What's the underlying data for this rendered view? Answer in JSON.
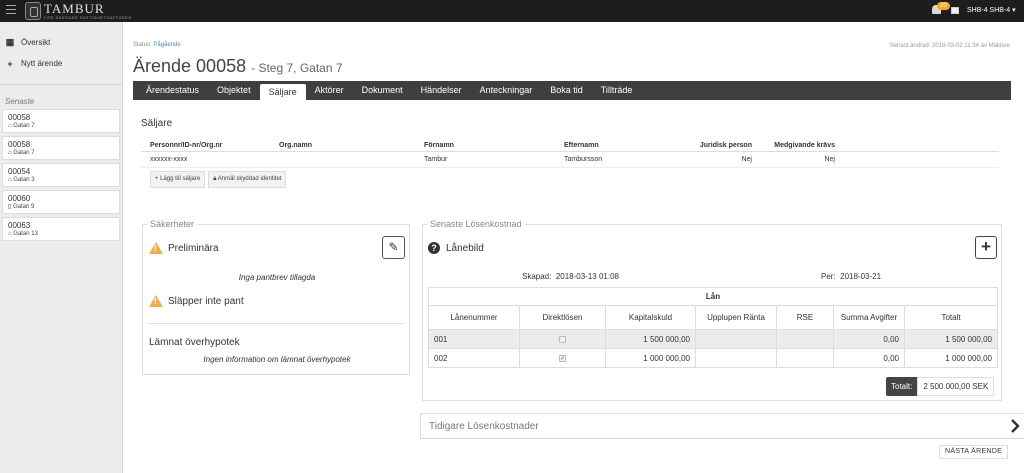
{
  "app": {
    "logo_text": "TAMBUR",
    "logo_sub": "FÖR SÄKRARE FASTIGHETSAFFÄRER",
    "notification_count": "20",
    "user": "SHB-4 SHB-4"
  },
  "sidebar": {
    "nav": [
      {
        "label": "Översikt",
        "icon": "grid-icon"
      },
      {
        "label": "Nytt ärende",
        "icon": "plus-icon"
      }
    ],
    "recent_heading": "Senaste",
    "recent": [
      {
        "number": "00058",
        "address": "Gatan 7",
        "icon": "home-icon"
      },
      {
        "number": "00058",
        "address": "Gatan 7",
        "icon": "home-icon"
      },
      {
        "number": "00054",
        "address": "Gatan 3",
        "icon": "home-icon"
      },
      {
        "number": "00060",
        "address": "Gatan 9",
        "icon": "building-icon"
      },
      {
        "number": "00063",
        "address": "Gatan 13",
        "icon": "home-icon"
      }
    ]
  },
  "header": {
    "status_label": "Status:",
    "status_value": "Pågående",
    "title": "Ärende 00058",
    "subtitle": "- Steg 7, Gatan 7",
    "last_changed": "Senast ändrad: 2018-03-02 11:34 av Mäklare"
  },
  "tabs": [
    {
      "label": "Ärendestatus"
    },
    {
      "label": "Objektet"
    },
    {
      "label": "Säljare",
      "active": true
    },
    {
      "label": "Aktörer"
    },
    {
      "label": "Dokument"
    },
    {
      "label": "Händelser"
    },
    {
      "label": "Anteckningar"
    },
    {
      "label": "Boka tid"
    },
    {
      "label": "Tillträde"
    }
  ],
  "seller": {
    "heading": "Säljare",
    "columns": [
      "Personnr/ID-nr/Org.nr",
      "Org.namn",
      "Förnamn",
      "Efternamn",
      "Juridisk person",
      "Medgivande krävs"
    ],
    "rows": [
      [
        "xxxxxx-xxxx",
        "",
        "Tambur",
        "Tambursson",
        "Nej",
        "Nej"
      ]
    ],
    "add_button": "+ Lägg till säljare",
    "protected_button": "Anmäl skyddad identitet"
  },
  "security": {
    "legend": "Säkerheter",
    "preliminary": "Preliminära",
    "no_mortgage": "Inga pantbrev tillagda",
    "no_release": "Släpper inte pant",
    "surplus_heading": "Lämnat överhypotek",
    "no_surplus": "Ingen information om lämnat överhypotek"
  },
  "redemption": {
    "legend": "Senaste Lösenkostnad",
    "title": "Lånebild",
    "created_label": "Skapad:",
    "created": "2018-03-13 01:08",
    "per_label": "Per:",
    "per": "2018-03-21",
    "table_caption": "Lån",
    "columns": [
      "Lånenummer",
      "Direktlösen",
      "Kapitalskuld",
      "Upplupen Ränta",
      "RSE",
      "Summa Avgifter",
      "Totalt"
    ],
    "rows": [
      {
        "loan": "001",
        "direct": false,
        "capital": "1 500 000,00",
        "interest": "",
        "rse": "",
        "fees": "0,00",
        "total": "1 500 000,00"
      },
      {
        "loan": "002",
        "direct": true,
        "capital": "1 000 000,00",
        "interest": "",
        "rse": "",
        "fees": "0,00",
        "total": "1 000 000,00"
      }
    ],
    "total_label": "Totalt:",
    "total_value": "2 500 000,00 SEK"
  },
  "previous_costs": "Tidigare Lösenkostnader",
  "next_button": "NÄSTA ÄRENDE"
}
